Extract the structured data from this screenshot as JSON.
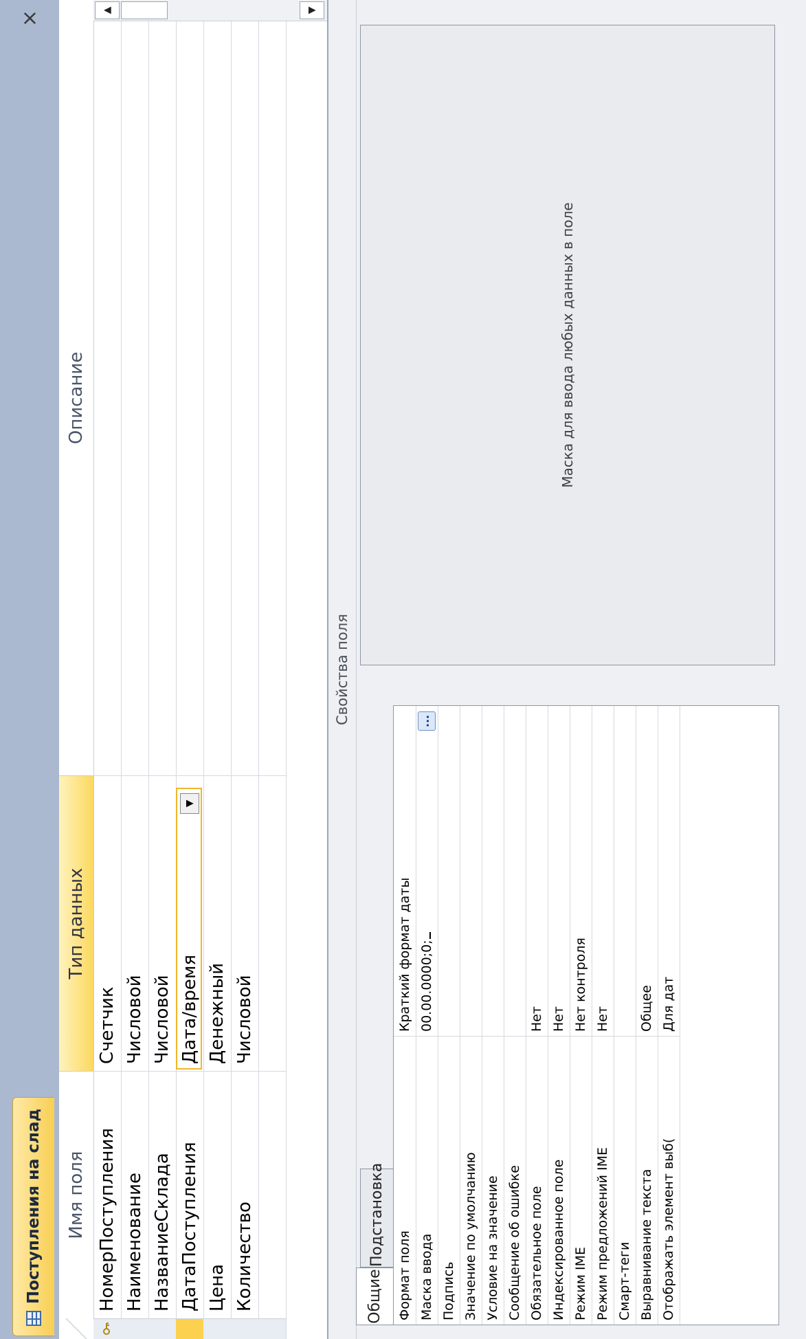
{
  "document_tab": {
    "title": "Поступления на слад",
    "close_glyph": "×"
  },
  "grid": {
    "headers": {
      "field_name": "Имя поля",
      "data_type": "Тип данных",
      "description": "Описание"
    },
    "rows": [
      {
        "name": "НомерПоступления",
        "type": "Счетчик",
        "key": true
      },
      {
        "name": "Наименование",
        "type": "Числовой"
      },
      {
        "name": "НазваниеСклада",
        "type": "Числовой"
      },
      {
        "name": "ДатаПоступления",
        "type": "Дата/время",
        "current": true
      },
      {
        "name": "Цена",
        "type": "Денежный"
      },
      {
        "name": "Количество",
        "type": "Числовой"
      }
    ],
    "dropdown_glyph": "▼",
    "scroll_up_glyph": "▲",
    "scroll_down_glyph": "▼"
  },
  "properties": {
    "caption": "Свойства поля",
    "tabs": [
      "Общие",
      "Подстановка"
    ],
    "active_tab": "Общие",
    "rows": [
      {
        "name": "Формат поля",
        "value": "Краткий формат даты"
      },
      {
        "name": "Маска ввода",
        "value": "00.00.0000;0;",
        "editing": true
      },
      {
        "name": "Подпись",
        "value": ""
      },
      {
        "name": "Значение по умолчанию",
        "value": ""
      },
      {
        "name": "Условие на значение",
        "value": ""
      },
      {
        "name": "Сообщение об ошибке",
        "value": ""
      },
      {
        "name": "Обязательное поле",
        "value": "Нет"
      },
      {
        "name": "Индексированное поле",
        "value": "Нет"
      },
      {
        "name": "Режим IME",
        "value": "Нет контроля"
      },
      {
        "name": "Режим предложений IME",
        "value": "Нет"
      },
      {
        "name": "Смарт-теги",
        "value": ""
      },
      {
        "name": "Выравнивание текста",
        "value": "Общее"
      },
      {
        "name": "Отображать элемент выб(",
        "value": "Для дат"
      }
    ],
    "builder_glyph": "...",
    "help_text": "Маска для ввода любых данных в поле"
  },
  "colors": {
    "active_tab": "#f8cf54",
    "current_row_selector": "#fcd14f",
    "tab_strip": "#abb9d0"
  }
}
